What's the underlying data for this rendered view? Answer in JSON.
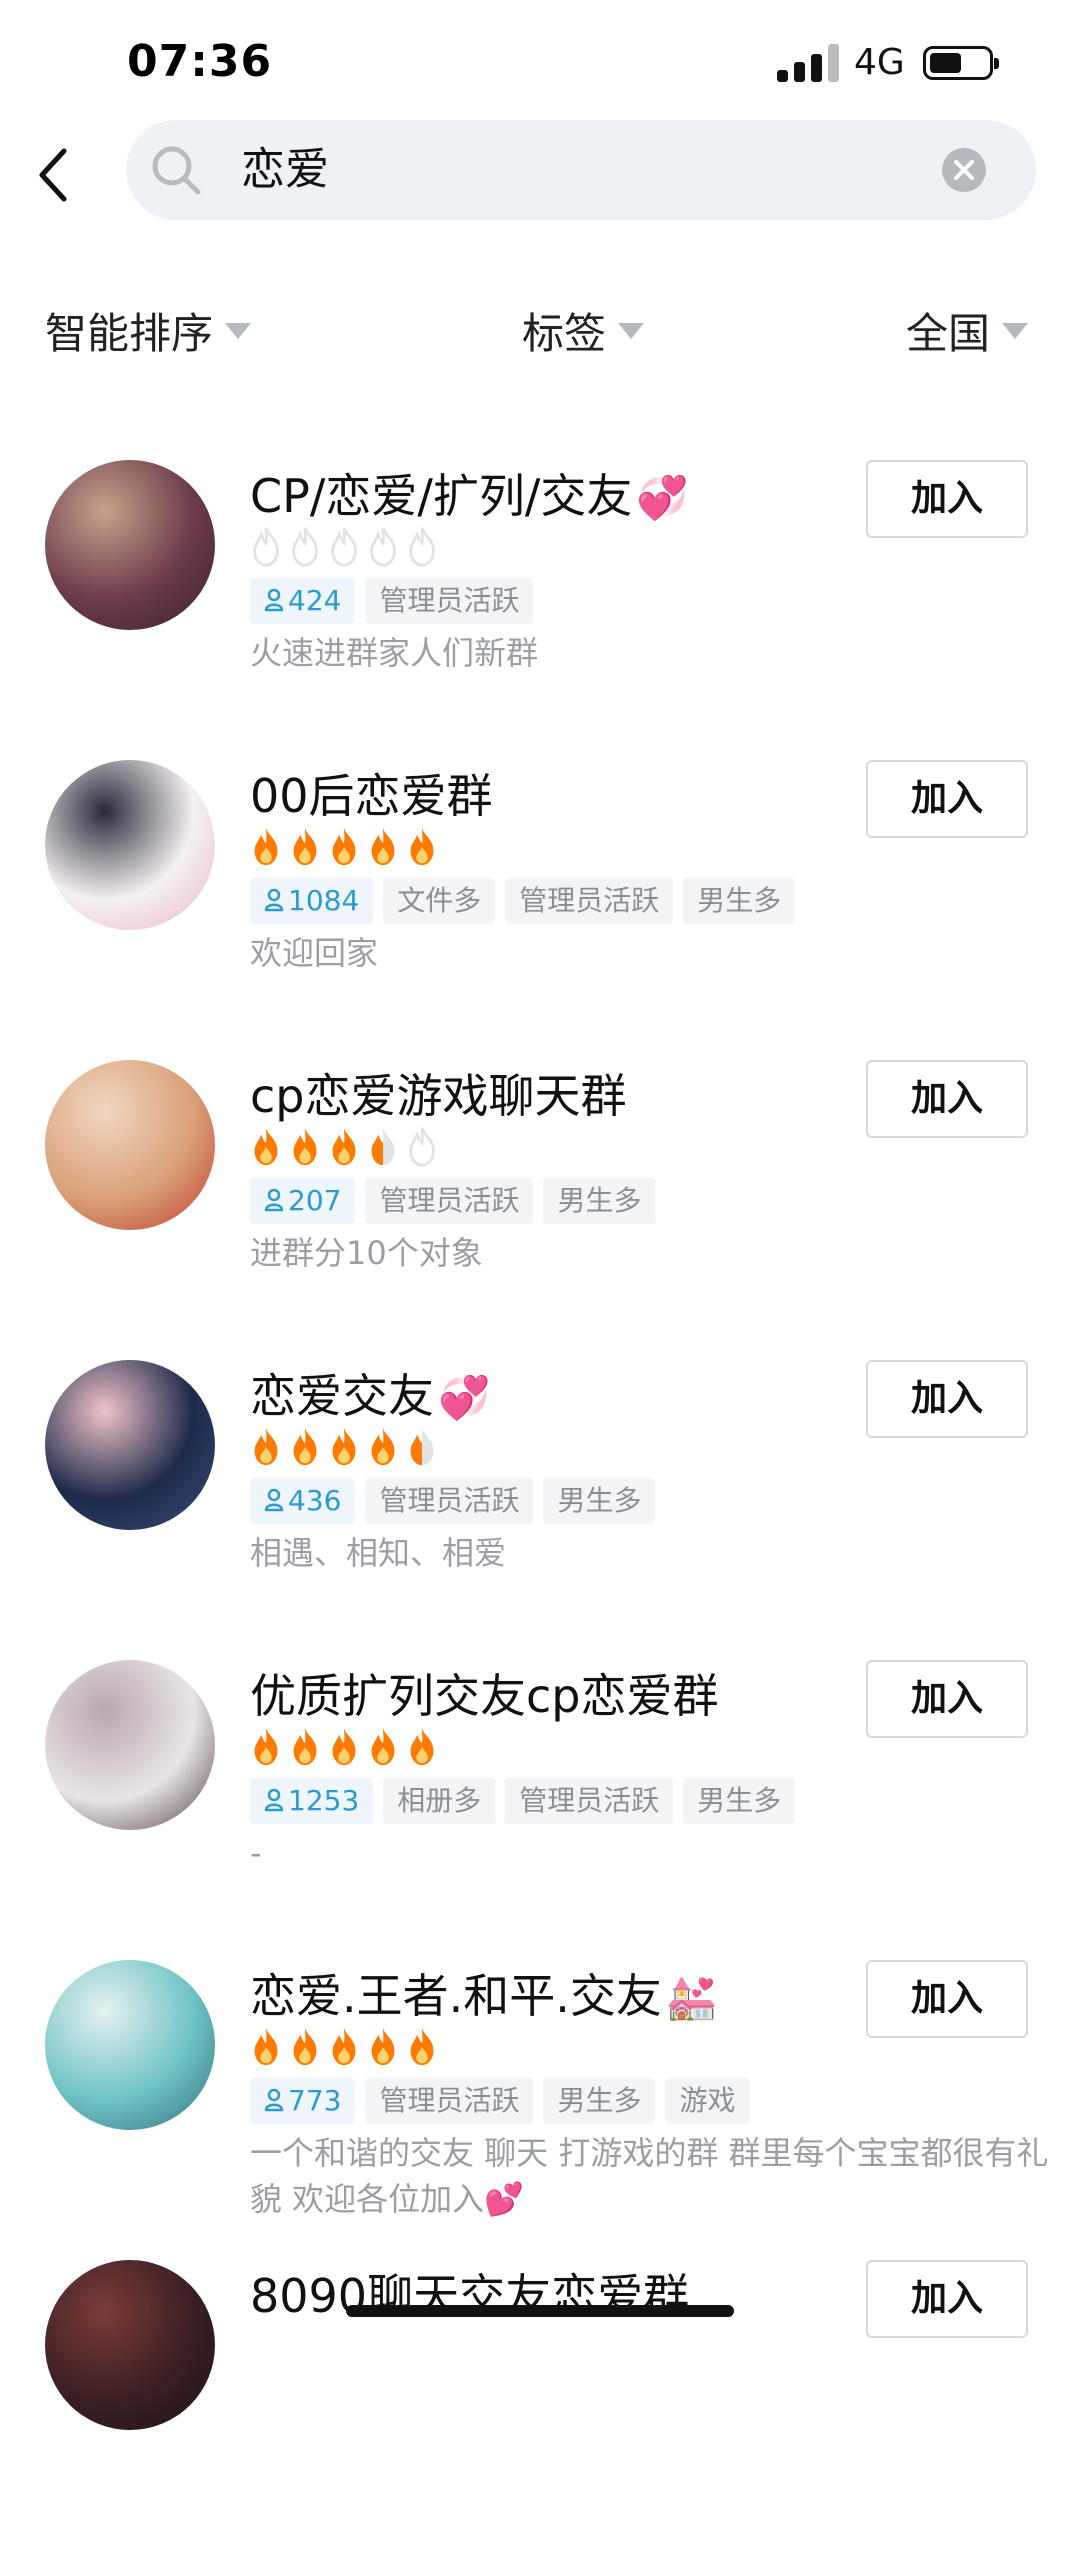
{
  "status_bar": {
    "time": "07:36",
    "network": "4G"
  },
  "search": {
    "query": "恋爱"
  },
  "filters": [
    {
      "label": "智能排序"
    },
    {
      "label": "标签"
    },
    {
      "label": "全国"
    }
  ],
  "groups": [
    {
      "name": "CP/恋爱/扩列/交友",
      "emoji": "💞",
      "heat": 0,
      "members": "424",
      "tags": [
        "管理员活跃"
      ],
      "desc": "火速进群家人们新群",
      "join_label": "加入",
      "avatar_colors": [
        "#6b3b4a",
        "#c7a28b",
        "#3a2230"
      ]
    },
    {
      "name": "00后恋爱群",
      "emoji": "",
      "heat": 5,
      "members": "1084",
      "tags": [
        "文件多",
        "管理员活跃",
        "男生多"
      ],
      "desc": "欢迎回家",
      "join_label": "加入",
      "avatar_colors": [
        "#f5f0f2",
        "#2b2a3a",
        "#e8b7c0"
      ]
    },
    {
      "name": "cp恋爱游戏聊天群",
      "emoji": "",
      "heat": 3.5,
      "members": "207",
      "tags": [
        "管理员活跃",
        "男生多"
      ],
      "desc": "进群分10个对象",
      "join_label": "加入",
      "avatar_colors": [
        "#d9a078",
        "#f1d7c2",
        "#c0392b"
      ]
    },
    {
      "name": "恋爱交友",
      "emoji": "💞",
      "heat": 4.5,
      "members": "436",
      "tags": [
        "管理员活跃",
        "男生多"
      ],
      "desc": "相遇、相知、相爱",
      "join_label": "加入",
      "avatar_colors": [
        "#1d2a4a",
        "#f0c3c9",
        "#3b4f7a"
      ]
    },
    {
      "name": "优质扩列交友cp恋爱群",
      "emoji": "",
      "heat": 5,
      "members": "1253",
      "tags": [
        "相册多",
        "管理员活跃",
        "男生多"
      ],
      "desc": "-",
      "join_label": "加入",
      "avatar_colors": [
        "#e9e4e6",
        "#b9a7b4",
        "#4a3a45"
      ]
    },
    {
      "name": "恋爱.王者.和平.交友",
      "emoji": "💒",
      "heat": 5,
      "members": "773",
      "tags": [
        "管理员活跃",
        "男生多",
        "游戏"
      ],
      "desc": "一个和谐的交友 聊天 打游戏的群 群里每个宝宝都很有礼貌 欢迎各位加入💕",
      "join_label": "加入",
      "avatar_colors": [
        "#6fc3c4",
        "#e6f1f0",
        "#2f6f77"
      ]
    },
    {
      "name": "8090聊天交友恋爱群",
      "emoji": "",
      "heat": 0,
      "members": "",
      "tags": [],
      "desc": "",
      "join_label": "加入",
      "avatar_colors": [
        "#3a1f22",
        "#7a3b3b",
        "#1f1214"
      ]
    }
  ],
  "colors": {
    "flame_active": "#ff7a00",
    "flame_inactive": "#e3e3e3",
    "members_tag": "#2a9bd1"
  }
}
